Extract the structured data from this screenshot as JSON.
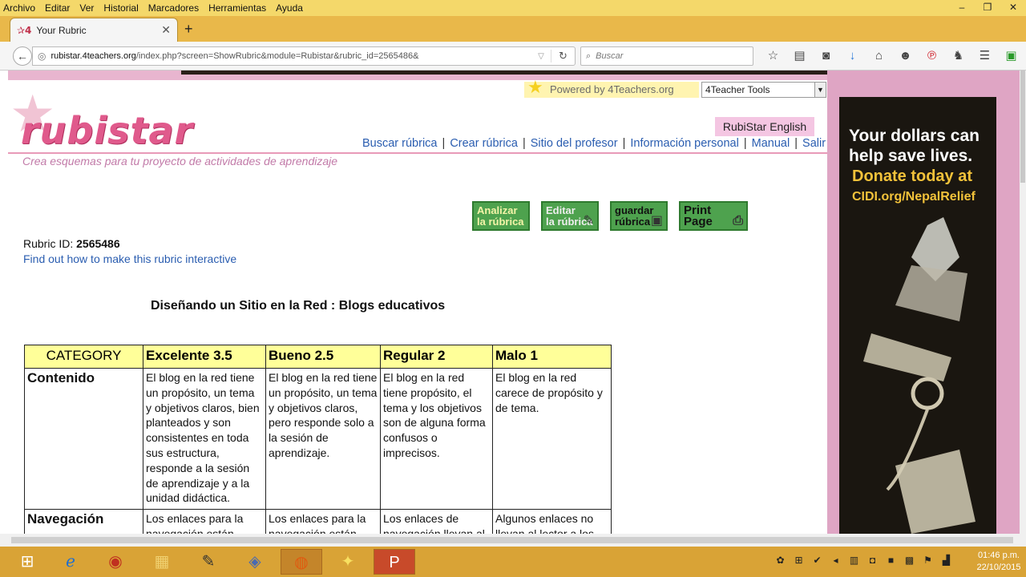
{
  "browser": {
    "menu": [
      "Archivo",
      "Editar",
      "Ver",
      "Historial",
      "Marcadores",
      "Herramientas",
      "Ayuda"
    ],
    "window_controls": [
      "–",
      "❐",
      "✕"
    ],
    "tab_title": "Your Rubric",
    "tab_favicon": "✰4",
    "tab_close": "✕",
    "new_tab": "+",
    "url_domain": "rubistar.4teachers.org",
    "url_path": "/index.php?screen=ShowRubric&module=Rubistar&rubric_id=2565486&",
    "search_placeholder": "Buscar",
    "toolbar_icons": [
      "☆",
      "▤",
      "◙",
      "↓",
      "⌂",
      "☻",
      "℗",
      "♞",
      "☰",
      "▣"
    ]
  },
  "site": {
    "powered": "Powered by 4Teachers.org",
    "tools_select": "4Teacher Tools",
    "logo": "rubistar",
    "english_link": "RubiStar English",
    "nav": [
      "Buscar rúbrica",
      "Crear rúbrica",
      "Sitio del profesor",
      "Información personal",
      "Manual",
      "Salir"
    ],
    "slogan": "Crea esquemas para tu proyecto de actividades de aprendizaje",
    "action_buttons": [
      {
        "label1": "Analizar",
        "label2": "la rúbrica"
      },
      {
        "label1": "Editar",
        "label2": "la rúbrica"
      },
      {
        "label1": "guardar",
        "label2": "rúbrica"
      },
      {
        "label1": "Print",
        "label2": "Page"
      }
    ]
  },
  "rubric": {
    "id_label": "Rubric ID:",
    "id_value": "2565486",
    "interactive_link": "Find out how to make this rubric interactive",
    "title": "Diseñando un Sitio en la Red : Blogs educativos",
    "headers": [
      "CATEGORY",
      "Excelente 3.5",
      "Bueno 2.5",
      "Regular 2",
      "Malo 1"
    ],
    "rows": [
      {
        "category": "Contenido",
        "cells": [
          "El blog en la red tiene un propósito, un tema y objetivos claros, bien planteados y son consistentes en toda sus estructura, responde a la sesión de aprendizaje y a la unidad didáctica.",
          "El blog en la red tiene un propósito, un tema y objetivos claros, pero responde solo a la sesión de aprendizaje.",
          "El blog en la red tiene propósito, el tema y los objetivos son de alguna forma confusos o imprecisos.",
          "El blog en la red carece de propósito y de tema."
        ]
      },
      {
        "category": "Navegación",
        "cells": [
          "Los enlaces para la navegación están",
          "Los enlaces para la navegación están",
          "Los enlaces de navegación llevan al",
          "Algunos enlaces no llevan al lector a los"
        ]
      }
    ]
  },
  "ad": {
    "line1": "Your dollars can",
    "line1b": "help save lives.",
    "line2": "Donate today at",
    "line3": "CIDI.org/NepalRelief"
  },
  "taskbar": {
    "icons": [
      "⊞",
      "ℯ",
      "◉",
      "▦",
      "✎",
      "◈",
      "◍",
      "✦",
      "P"
    ],
    "time": "01:46 p.m.",
    "date": "22/10/2015"
  }
}
